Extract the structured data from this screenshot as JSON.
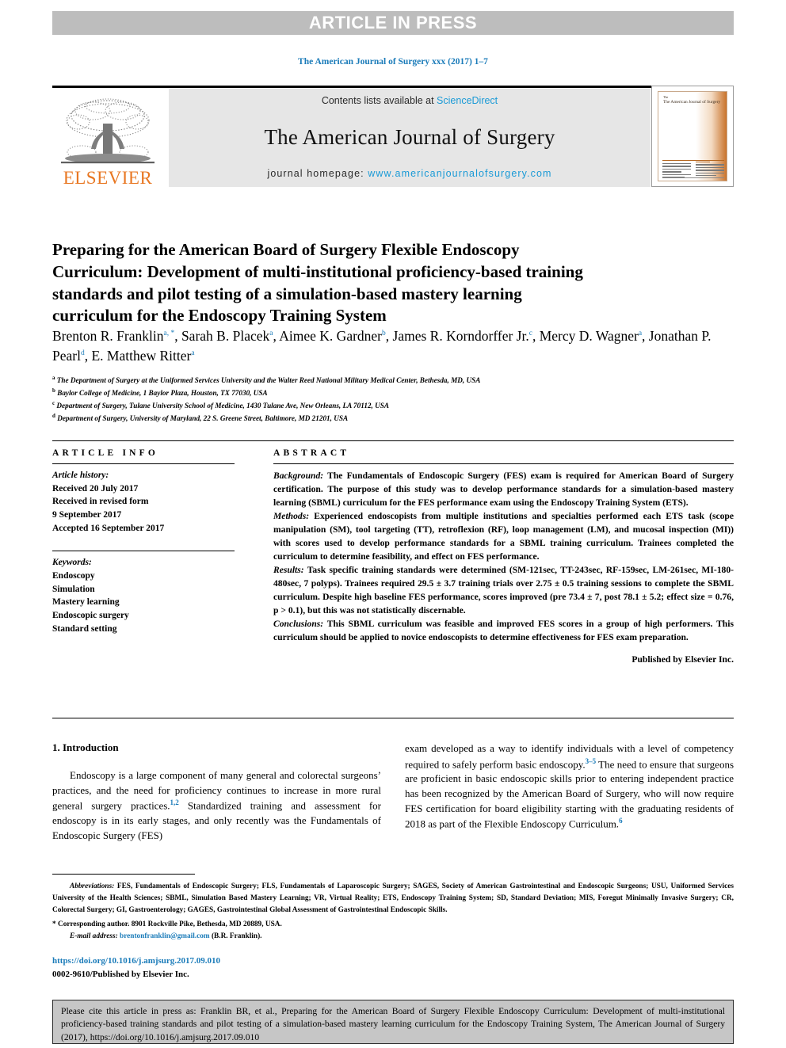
{
  "banner": {
    "label": "ARTICLE IN PRESS"
  },
  "journal_ref": "The American Journal of Surgery xxx (2017) 1–7",
  "masthead": {
    "contents_prefix": "Contents lists available at ",
    "contents_link": "ScienceDirect",
    "journal_title": "The American Journal of Surgery",
    "homepage_prefix": "journal homepage: ",
    "homepage_url": "www.americanjournalofsurgery.com",
    "publisher_logo_text": "ELSEVIER",
    "cover_title": "The American Journal of Surgery",
    "cover_title_the": "The"
  },
  "article": {
    "title": "Preparing for the American Board of Surgery Flexible Endoscopy Curriculum: Development of multi-institutional proficiency-based training standards and pilot testing of a simulation-based mastery learning curriculum for the Endoscopy Training System",
    "authors": [
      {
        "name": "Brenton R. Franklin",
        "marks": "a, *"
      },
      {
        "name": "Sarah B. Placek",
        "marks": "a"
      },
      {
        "name": "Aimee K. Gardner",
        "marks": "b"
      },
      {
        "name": "James R. Korndorffer Jr.",
        "marks": "c"
      },
      {
        "name": "Mercy D. Wagner",
        "marks": "a"
      },
      {
        "name": "Jonathan P. Pearl",
        "marks": "d"
      },
      {
        "name": "E. Matthew Ritter",
        "marks": "a"
      }
    ],
    "affiliations": [
      {
        "mark": "a",
        "text": "The Department of Surgery at the Uniformed Services University and the Walter Reed National Military Medical Center, Bethesda, MD, USA"
      },
      {
        "mark": "b",
        "text": "Baylor College of Medicine, 1 Baylor Plaza, Houston, TX 77030, USA"
      },
      {
        "mark": "c",
        "text": "Department of Surgery, Tulane University School of Medicine, 1430 Tulane Ave, New Orleans, LA 70112, USA"
      },
      {
        "mark": "d",
        "text": "Department of Surgery, University of Maryland, 22 S. Greene Street, Baltimore, MD 21201, USA"
      }
    ]
  },
  "article_info": {
    "heading": "ARTICLE INFO",
    "history_label": "Article history:",
    "history_lines": [
      "Received 20 July 2017",
      "Received in revised form",
      "9 September 2017",
      "Accepted 16 September 2017"
    ],
    "keywords_label": "Keywords:",
    "keywords": [
      "Endoscopy",
      "Simulation",
      "Mastery learning",
      "Endoscopic surgery",
      "Standard setting"
    ]
  },
  "abstract": {
    "heading": "ABSTRACT",
    "background_label": "Background:",
    "background_text": " The Fundamentals of Endoscopic Surgery (FES) exam is required for American Board of Surgery certification. The purpose of this study was to develop performance standards for a simulation-based mastery learning (SBML) curriculum for the FES performance exam using the Endoscopy Training System (ETS).",
    "methods_label": "Methods:",
    "methods_text": " Experienced endoscopists from multiple institutions and specialties performed each ETS task (scope manipulation (SM), tool targeting (TT), retroflexion (RF), loop management (LM), and mucosal inspection (MI)) with scores used to develop performance standards for a SBML training curriculum. Trainees completed the curriculum to determine feasibility, and effect on FES performance.",
    "results_label": "Results:",
    "results_text": " Task specific training standards were determined (SM-121sec, TT-243sec, RF-159sec, LM-261sec, MI-180-480sec, 7 polyps). Trainees required 29.5 ± 3.7 training trials over 2.75 ± 0.5 training sessions to complete the SBML curriculum. Despite high baseline FES performance, scores improved (pre 73.4 ± 7, post 78.1 ± 5.2; effect size = 0.76, p > 0.1), but this was not statistically discernable.",
    "conclusions_label": "Conclusions:",
    "conclusions_text": " This SBML curriculum was feasible and improved FES scores in a group of high performers. This curriculum should be applied to novice endoscopists to determine effectiveness for FES exam preparation.",
    "published_by": "Published by Elsevier Inc."
  },
  "introduction": {
    "heading": "1. Introduction",
    "left_part1": "Endoscopy is a large component of many general and colorectal surgeons’ practices, and the need for proficiency continues to increase in more rural general surgery practices.",
    "left_ref1": "1,2",
    "left_part2": " Standardized training and assessment for endoscopy is in its early stages, and only recently was the Fundamentals of Endoscopic Surgery (FES)",
    "right_part1": "exam developed as a way to identify individuals with a level of competency required to safely perform basic endoscopy.",
    "right_ref1": "3–5",
    "right_part2": " The need to ensure that surgeons are proficient in basic endoscopic skills prior to entering independent practice has been recognized by the American Board of Surgery, who will now require FES certification for board eligibility starting with the graduating residents of 2018 as part of the Flexible Endoscopy Curriculum.",
    "right_ref2": "6"
  },
  "footnotes": {
    "abbrev_label": "Abbreviations:",
    "abbrev_text": " FES, Fundamentals of Endoscopic Surgery; FLS, Fundamentals of Laparoscopic Surgery; SAGES, Society of American Gastrointestinal and Endoscopic Surgeons; USU, Uniformed Services University of the Health Sciences; SBML, Simulation Based Mastery Learning; VR, Virtual Reality; ETS, Endoscopy Training System; SD, Standard Deviation; MIS, Foregut Minimally Invasive Surgery; CR, Colorectal Surgery; GI, Gastroenterology; GAGES, Gastrointestinal Global Assessment of Gastrointestinal Endoscopic Skills.",
    "corresponding": "Corresponding author. 8901 Rockville Pike, Bethesda, MD 20889, USA.",
    "email_label": "E-mail address:",
    "email": "brentonfranklin@gmail.com",
    "email_suffix": " (B.R. Franklin)."
  },
  "doi_block": {
    "doi_url": "https://doi.org/10.1016/j.amjsurg.2017.09.010",
    "issn_line": "0002-9610/Published by Elsevier Inc."
  },
  "citation_box": {
    "text": "Please cite this article in press as: Franklin BR, et al., Preparing for the American Board of Surgery Flexible Endoscopy Curriculum: Development of multi-institutional proficiency-based training standards and pilot testing of a simulation-based mastery learning curriculum for the Endoscopy Training System, The American Journal of Surgery (2017), https://doi.org/10.1016/j.amjsurg.2017.09.010"
  },
  "colors": {
    "link_blue": "#1a7bb9",
    "sd_blue": "#1a9ad6",
    "elsevier_orange": "#E87722",
    "banner_gray": "#bdbdbd",
    "panel_gray": "#e6e6e6",
    "cite_gray": "#c6c6c6"
  }
}
